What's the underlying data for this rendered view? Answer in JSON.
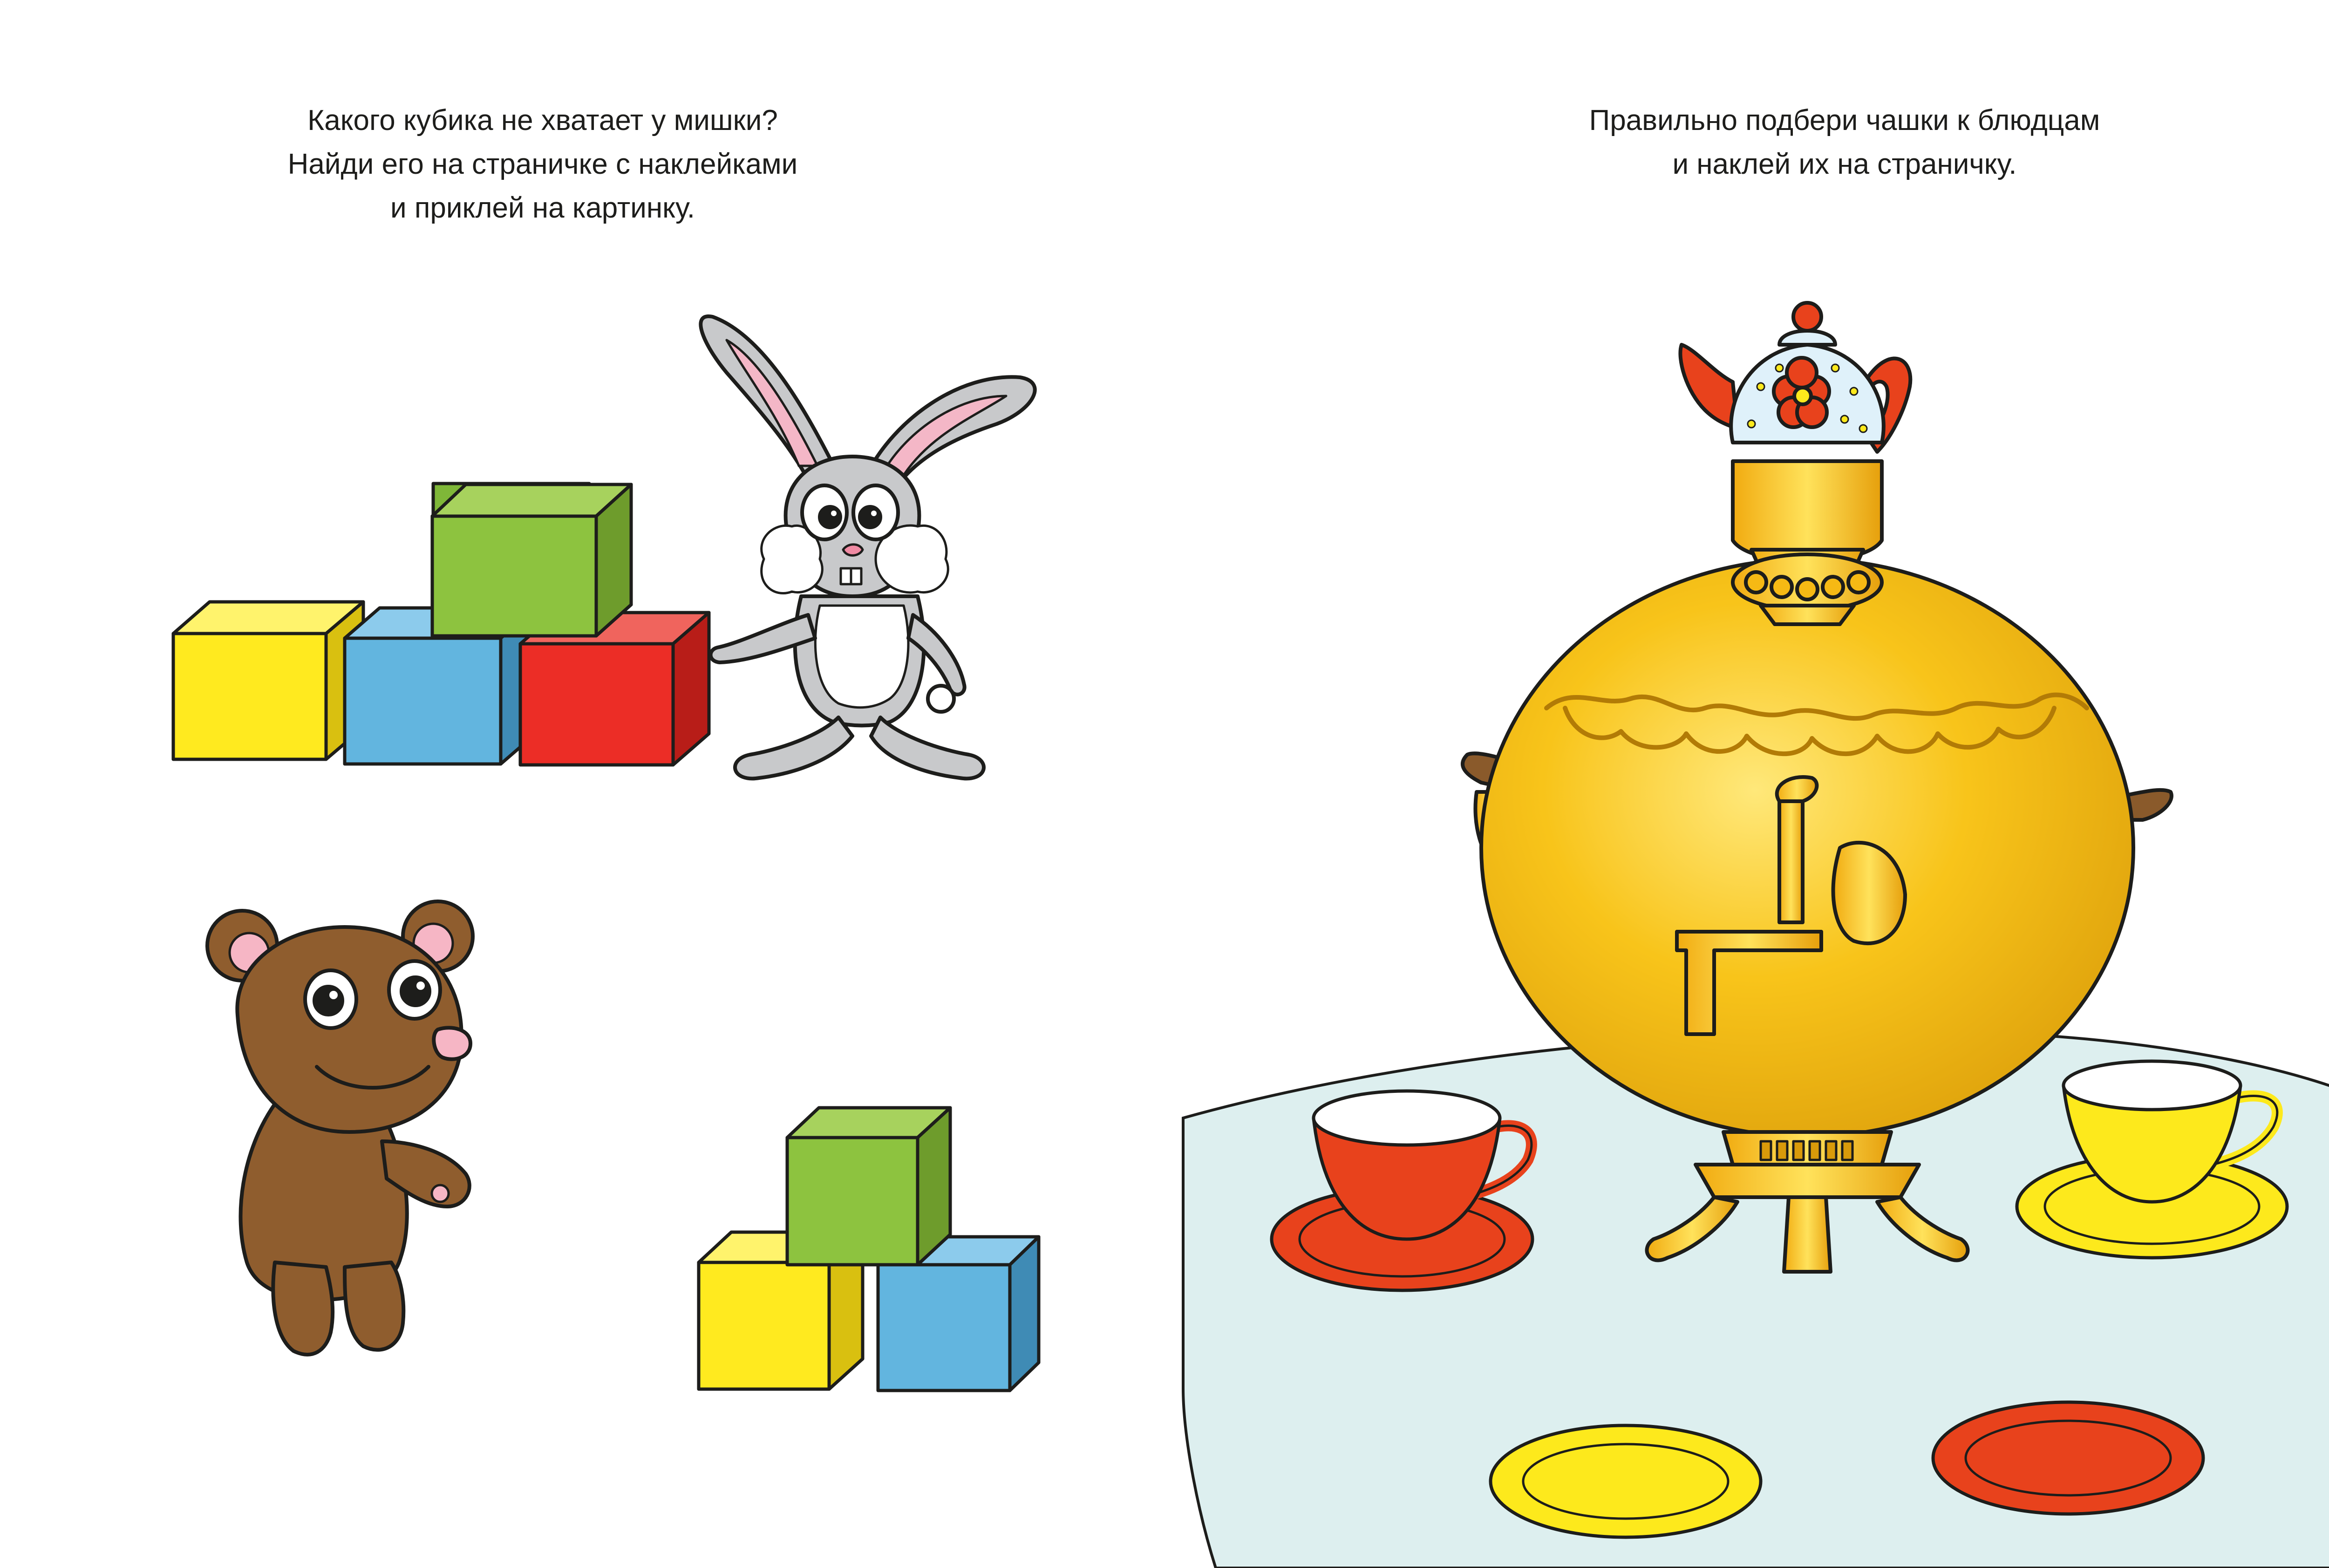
{
  "left_page": {
    "instruction": [
      "Какого кубика не хватает у мишки?",
      "Найди его на страничке с наклейками",
      "и приклей на картинку."
    ]
  },
  "right_page": {
    "instruction": [
      "Правильно подбери чашки к блюдцам",
      "и наклей их на страничку."
    ]
  },
  "colors": {
    "cube_yellow": "#ffea1f",
    "cube_blue": "#62b5df",
    "cube_green": "#8dc33f",
    "cube_red": "#ec2d26",
    "bear_brown": "#8f5d2e",
    "bunny_gray": "#c8c9cb",
    "samovar_gold": "#f6b914",
    "table_cloth": "#ddefef",
    "cup_orange": "#e8421c",
    "cup_yellow": "#fde91c"
  }
}
